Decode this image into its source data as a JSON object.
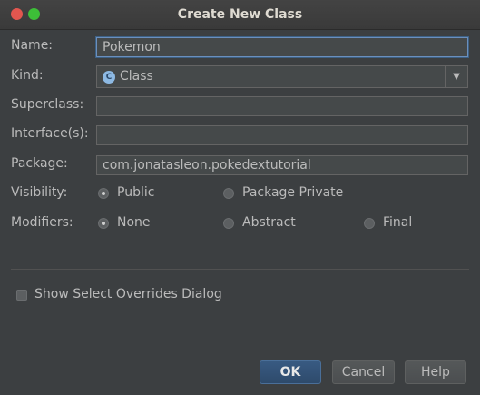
{
  "window": {
    "title": "Create New Class"
  },
  "form": {
    "name": {
      "label": "Name:",
      "value": "Pokemon"
    },
    "kind": {
      "label": "Kind:",
      "value": "Class",
      "icon": "class-c-icon",
      "icon_letter": "C"
    },
    "superclass": {
      "label": "Superclass:",
      "value": ""
    },
    "interfaces": {
      "label": "Interface(s):",
      "value": ""
    },
    "package": {
      "label": "Package:",
      "value": "com.jonatasleon.pokedextutorial"
    },
    "visibility": {
      "label": "Visibility:",
      "options": [
        {
          "label": "Public",
          "selected": true
        },
        {
          "label": "Package Private",
          "selected": false
        }
      ]
    },
    "modifiers": {
      "label": "Modifiers:",
      "options": [
        {
          "label": "None",
          "selected": true
        },
        {
          "label": "Abstract",
          "selected": false
        },
        {
          "label": "Final",
          "selected": false
        }
      ]
    },
    "show_overrides": {
      "label": "Show Select Overrides Dialog",
      "checked": false
    }
  },
  "buttons": {
    "ok": "OK",
    "cancel": "Cancel",
    "help": "Help"
  },
  "colors": {
    "background": "#3c3f41",
    "field": "#45494a",
    "focus": "#6b8fbd",
    "ok_button": "#385a82",
    "close": "#e2564f",
    "maximize": "#3dbf38"
  }
}
